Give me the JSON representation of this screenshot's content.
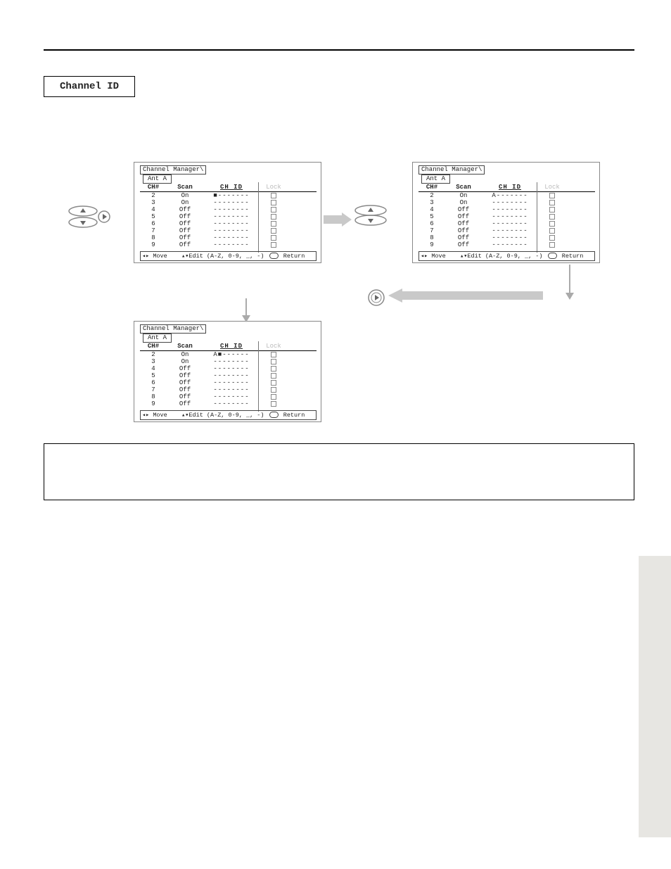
{
  "page": {
    "section_label": "Channel ID",
    "intro_line1": "",
    "intro_line2": "",
    "side_tab": "",
    "page_number": ""
  },
  "remote_hint": {
    "nav_play": "▶"
  },
  "panel_common": {
    "title": "Channel Manager\\",
    "antenna": "Ant A",
    "headers": {
      "ch": "CH#",
      "scan": "Scan",
      "chid": "CH ID",
      "lock": "Lock"
    },
    "footer_move": "◂▸ Move",
    "footer_edit": "▴▾Edit (A-Z, 0-9, _, -)",
    "footer_return": "Return"
  },
  "panel1_rows": [
    {
      "ch": "2",
      "scan": "On",
      "chid": "■-------"
    },
    {
      "ch": "3",
      "scan": "On",
      "chid": "--------"
    },
    {
      "ch": "4",
      "scan": "Off",
      "chid": "--------"
    },
    {
      "ch": "5",
      "scan": "Off",
      "chid": "--------"
    },
    {
      "ch": "6",
      "scan": "Off",
      "chid": "--------"
    },
    {
      "ch": "7",
      "scan": "Off",
      "chid": "--------"
    },
    {
      "ch": "8",
      "scan": "Off",
      "chid": "--------"
    },
    {
      "ch": "9",
      "scan": "Off",
      "chid": "--------"
    }
  ],
  "panel2_rows": [
    {
      "ch": "2",
      "scan": "On",
      "chid": "A-------"
    },
    {
      "ch": "3",
      "scan": "On",
      "chid": "--------"
    },
    {
      "ch": "4",
      "scan": "Off",
      "chid": "--------"
    },
    {
      "ch": "5",
      "scan": "Off",
      "chid": "--------"
    },
    {
      "ch": "6",
      "scan": "Off",
      "chid": "--------"
    },
    {
      "ch": "7",
      "scan": "Off",
      "chid": "--------"
    },
    {
      "ch": "8",
      "scan": "Off",
      "chid": "--------"
    },
    {
      "ch": "9",
      "scan": "Off",
      "chid": "--------"
    }
  ],
  "panel3_rows": [
    {
      "ch": "2",
      "scan": "On",
      "chid": "A■------"
    },
    {
      "ch": "3",
      "scan": "On",
      "chid": "--------"
    },
    {
      "ch": "4",
      "scan": "Off",
      "chid": "--------"
    },
    {
      "ch": "5",
      "scan": "Off",
      "chid": "--------"
    },
    {
      "ch": "6",
      "scan": "Off",
      "chid": "--------"
    },
    {
      "ch": "7",
      "scan": "Off",
      "chid": "--------"
    },
    {
      "ch": "8",
      "scan": "Off",
      "chid": "--------"
    },
    {
      "ch": "9",
      "scan": "Off",
      "chid": "--------"
    }
  ],
  "note": {
    "label": "",
    "items": [
      "",
      "",
      ""
    ]
  }
}
